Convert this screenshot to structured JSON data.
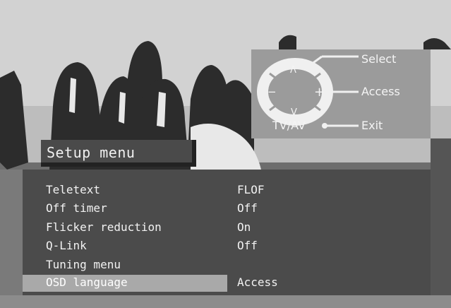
{
  "osd": {
    "title": "Setup menu",
    "items": [
      {
        "label": "Teletext",
        "value": "FLOF"
      },
      {
        "label": "Off timer",
        "value": "Off"
      },
      {
        "label": "Flicker reduction",
        "value": "On"
      },
      {
        "label": "Q-Link",
        "value": "Off"
      },
      {
        "label": "Tuning menu",
        "value": ""
      },
      {
        "label": "OSD language",
        "value": "Access"
      }
    ],
    "selected_index": 5
  },
  "help": {
    "select_label": "Select",
    "access_label": "Access",
    "exit_label": "Exit",
    "tvav_label": "TV/AV",
    "pad_glyphs": {
      "up": "Λ",
      "down": "V",
      "minus": "−",
      "plus": "+"
    }
  },
  "colors": {
    "panel": "#4b4b4b",
    "selection": "#a9a9a9",
    "help_panel": "#9b9b9b",
    "text": "#f2f2f2"
  }
}
